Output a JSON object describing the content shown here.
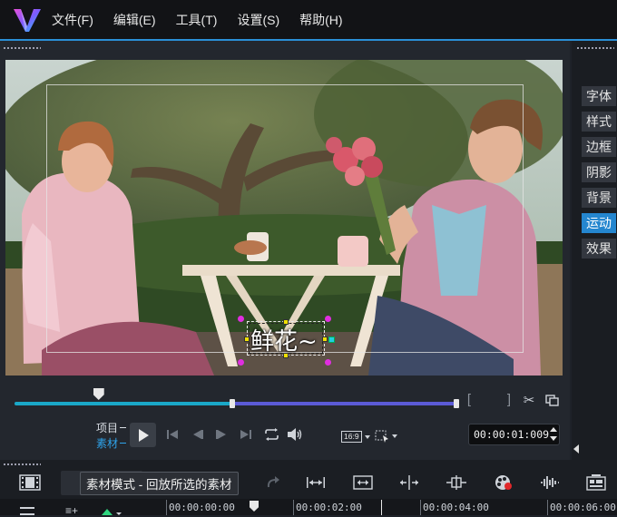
{
  "menu": [
    "文件(F)",
    "编辑(E)",
    "工具(T)",
    "设置(S)",
    "帮助(H)"
  ],
  "side_tabs": [
    {
      "label": "字体",
      "active": false
    },
    {
      "label": "样式",
      "active": false
    },
    {
      "label": "边框",
      "active": false
    },
    {
      "label": "阴影",
      "active": false
    },
    {
      "label": "背景",
      "active": false
    },
    {
      "label": "运动",
      "active": true
    },
    {
      "label": "效果",
      "active": false
    }
  ],
  "preview": {
    "caption_text": "鲜花~"
  },
  "mode": {
    "project_label": "项目",
    "clip_label": "素材"
  },
  "aspect_ratio": "16:9",
  "timecode": "00:00:01:009",
  "playback": {
    "playhead": 0.19,
    "in": 0.0,
    "out": 1.0,
    "trim_start": 0.49
  },
  "tooltip": "素材模式 - 回放所选的素材",
  "ruler": [
    "00:00:00:00",
    "00:00:02:00",
    "00:00:04:00",
    "00:00:06:00"
  ],
  "colors": {
    "accent": "#2a8fd6",
    "track_cyan": "#1aa8c8",
    "track_purple": "#5b5bd6",
    "active_tab": "#2486cf"
  }
}
